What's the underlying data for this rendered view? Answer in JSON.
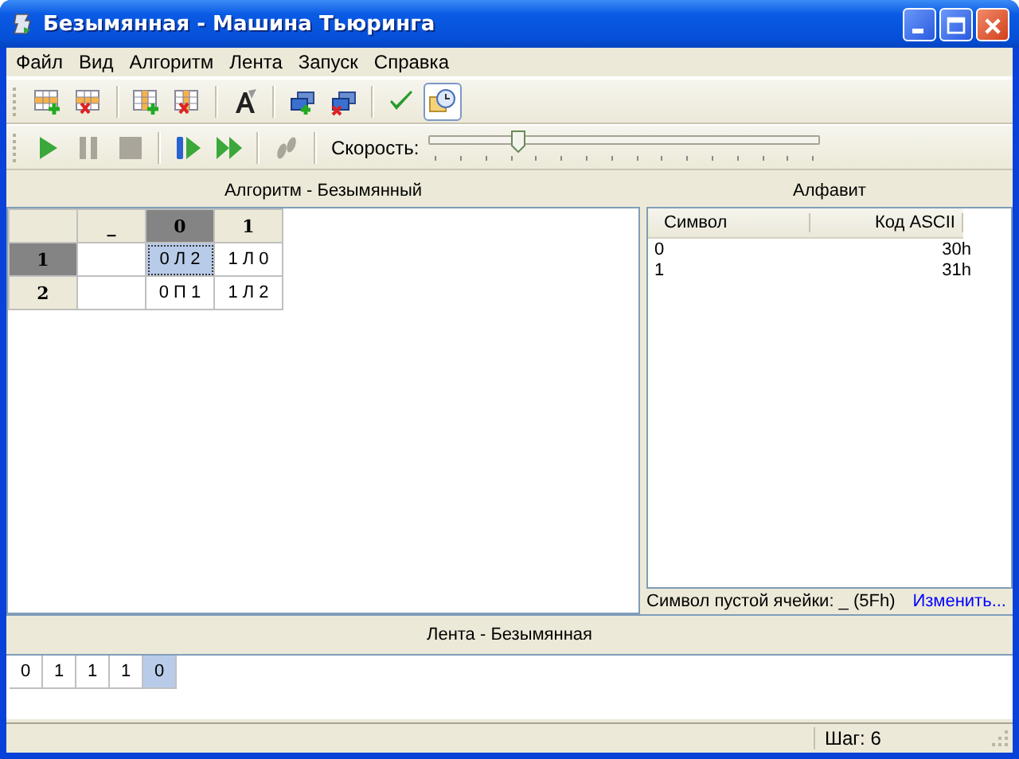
{
  "window": {
    "title": "Безымянная - Машина Тьюринга"
  },
  "menu": [
    "Файл",
    "Вид",
    "Алгоритм",
    "Лента",
    "Запуск",
    "Справка"
  ],
  "toolbar1": [
    [
      {
        "kind": "row-add",
        "pressed": false
      },
      {
        "kind": "row-delete",
        "pressed": false
      }
    ],
    [
      {
        "kind": "col-add",
        "pressed": false
      },
      {
        "kind": "col-delete",
        "pressed": false
      }
    ],
    [
      {
        "kind": "font",
        "pressed": false
      }
    ],
    [
      {
        "kind": "state-add",
        "pressed": false
      },
      {
        "kind": "state-delete",
        "pressed": false
      }
    ],
    [
      {
        "kind": "check",
        "pressed": false
      },
      {
        "kind": "clock",
        "pressed": true
      }
    ]
  ],
  "toolbar2": [
    [
      {
        "kind": "play",
        "disabled": false,
        "pressed": false
      },
      {
        "kind": "pause",
        "disabled": true,
        "pressed": false
      },
      {
        "kind": "stop",
        "disabled": true,
        "pressed": false
      }
    ],
    [
      {
        "kind": "step",
        "disabled": false,
        "pressed": false
      },
      {
        "kind": "fast",
        "disabled": false,
        "pressed": false
      }
    ],
    [
      {
        "kind": "steps",
        "disabled": true,
        "pressed": false
      }
    ]
  ],
  "speed": {
    "label": "Скорость:",
    "level": 0.22
  },
  "algorithm": {
    "title": "Алгоритм - Безымянный",
    "columns": [
      {
        "label": "_",
        "selected": false
      },
      {
        "label": "0",
        "selected": true
      },
      {
        "label": "1",
        "selected": false
      }
    ],
    "rows": [
      {
        "label": "1",
        "selected": true,
        "cells": [
          null,
          {
            "text": "0 Л 2",
            "focused": true
          },
          {
            "text": "1 Л 0",
            "focused": false
          }
        ]
      },
      {
        "label": "2",
        "selected": false,
        "cells": [
          null,
          {
            "text": "0 П 1",
            "focused": false
          },
          {
            "text": "1 Л 2",
            "focused": false
          }
        ]
      }
    ]
  },
  "alphabet": {
    "title": "Алфавит",
    "columns": [
      "Символ",
      "Код ASCII"
    ],
    "rows": [
      {
        "symbol": "0",
        "code": "30h"
      },
      {
        "symbol": "1",
        "code": "31h"
      }
    ],
    "empty_symbol": "Символ пустой ячейки: _ (5Fh)",
    "change_link": "Изменить..."
  },
  "tape": {
    "title": "Лента - Безымянная",
    "cells": [
      {
        "symbol": "0",
        "selected": false
      },
      {
        "symbol": "1",
        "selected": false
      },
      {
        "symbol": "1",
        "selected": false
      },
      {
        "symbol": "1",
        "selected": false
      },
      {
        "symbol": "0",
        "selected": true
      }
    ]
  },
  "status_bar": {
    "step": "Шаг: 6"
  }
}
